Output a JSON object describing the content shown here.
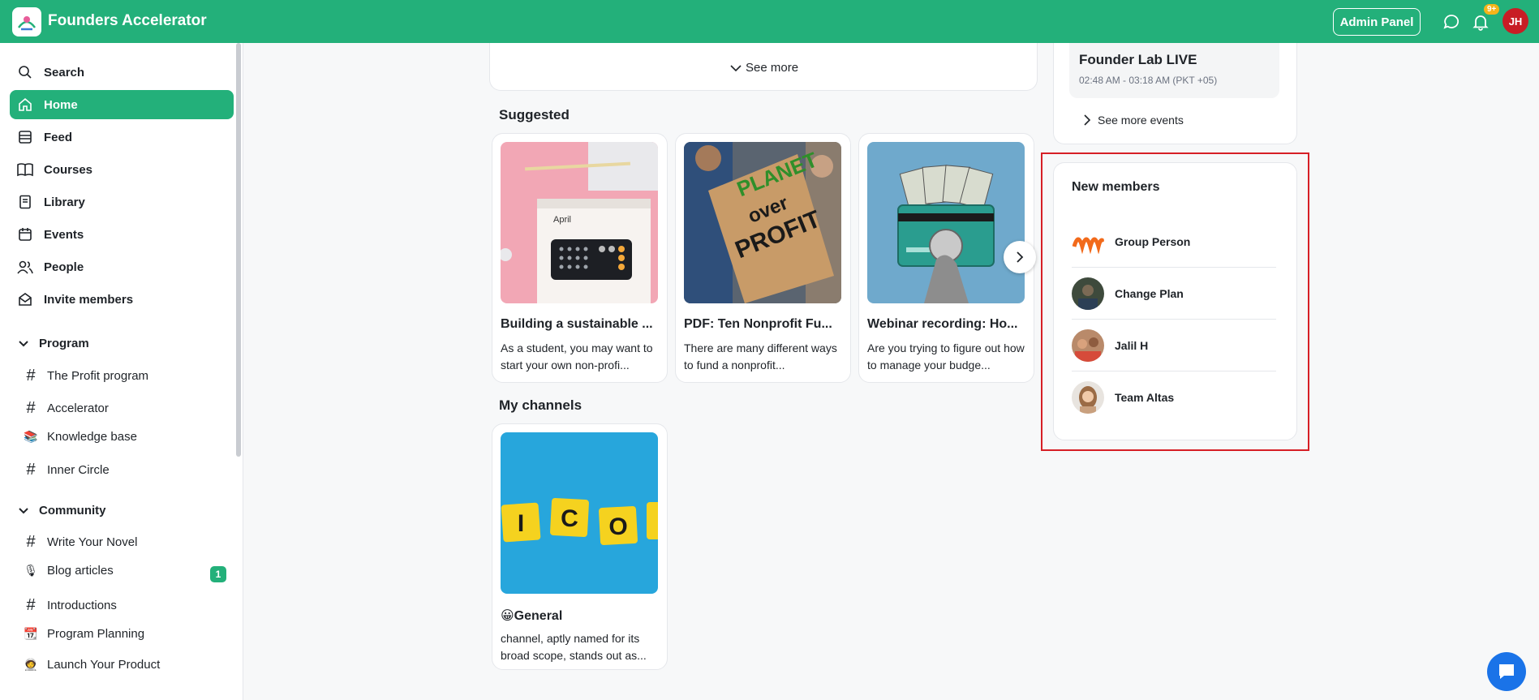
{
  "header": {
    "app_title": "Founders Accelerator",
    "admin_panel_label": "Admin Panel",
    "notification_badge": "9+",
    "user_initials": "JH",
    "brand_color": "#23b07a"
  },
  "sidebar": {
    "nav": [
      {
        "label": "Search",
        "icon": "search-icon"
      },
      {
        "label": "Home",
        "icon": "home-icon",
        "active": true
      },
      {
        "label": "Feed",
        "icon": "feed-icon"
      },
      {
        "label": "Courses",
        "icon": "book-icon"
      },
      {
        "label": "Library",
        "icon": "library-icon"
      },
      {
        "label": "Events",
        "icon": "calendar-icon"
      },
      {
        "label": "People",
        "icon": "people-icon"
      },
      {
        "label": "Invite members",
        "icon": "envelope-icon"
      }
    ],
    "sections": [
      {
        "title": "Program",
        "channels": [
          {
            "label": "The Profit program",
            "icon": "hash-icon"
          },
          {
            "label": "Accelerator",
            "icon": "hash-icon"
          },
          {
            "label": "Knowledge base",
            "icon": "books-emoji-icon"
          },
          {
            "label": "Inner Circle",
            "icon": "hash-icon"
          }
        ]
      },
      {
        "title": "Community",
        "channels": [
          {
            "label": "Write Your Novel",
            "icon": "hash-icon"
          },
          {
            "label": "Blog articles",
            "icon": "microphone-emoji-icon",
            "badge": "1"
          },
          {
            "label": "Introductions",
            "icon": "hash-icon"
          },
          {
            "label": "Program Planning",
            "icon": "calendar-emoji-icon"
          },
          {
            "label": "Launch Your Product",
            "icon": "rocket-emoji-icon"
          }
        ]
      }
    ]
  },
  "main": {
    "see_more_label": "See more",
    "suggested_title": "Suggested",
    "suggested": [
      {
        "title": "Building a sustainable ...",
        "desc": "As a student, you may want to start your own non-profi..."
      },
      {
        "title": "PDF: Ten Nonprofit Fu...",
        "desc": "There are many different ways to fund a nonprofit..."
      },
      {
        "title": "Webinar recording: Ho...",
        "desc": "Are you trying to figure out how to manage your budge..."
      }
    ],
    "channels_title": "My channels",
    "channels": [
      {
        "title": "😀General",
        "desc": "channel, aptly named for its broad scope, stands out as..."
      }
    ],
    "thumb_text": {
      "april": "April",
      "planet": "PLANET",
      "over": "over",
      "profit": "PROFIT",
      "tiles": [
        "I",
        "C",
        "O"
      ]
    }
  },
  "right": {
    "event_title": "Founder Lab LIVE",
    "event_time": "02:48 AM - 03:18 AM (PKT +05)",
    "see_more_events_label": "See more events",
    "new_members_title": "New members",
    "members": [
      {
        "name": "Group Person"
      },
      {
        "name": "Change Plan"
      },
      {
        "name": "Jalil H"
      },
      {
        "name": "Team Altas"
      }
    ]
  }
}
